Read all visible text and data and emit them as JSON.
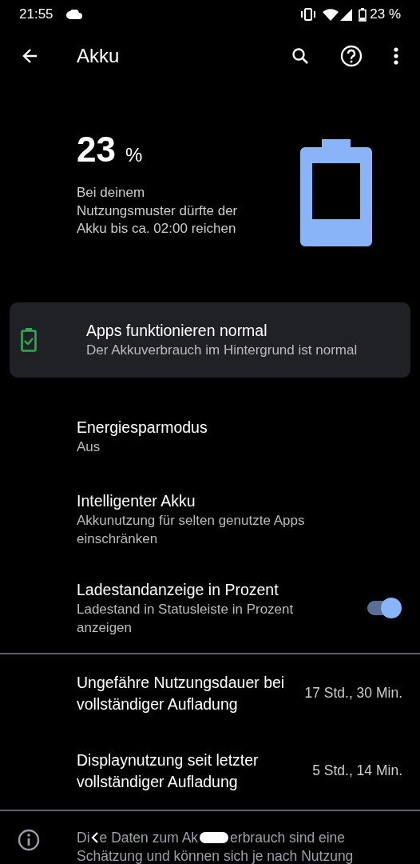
{
  "status_bar": {
    "time": "21:55",
    "battery_text": "23 %"
  },
  "toolbar": {
    "title": "Akku"
  },
  "summary": {
    "percent": "23",
    "unit": "%",
    "estimate": "Bei deinem Nutzungsmuster dürfte der Akku bis ca. 02:00 reichen"
  },
  "tip_card": {
    "title": "Apps funktionieren normal",
    "subtitle": "Der Akkuverbrauch im Hintergrund ist normal"
  },
  "settings": [
    {
      "kind": "text",
      "title": "Energiesparmodus",
      "subtitle": "Aus"
    },
    {
      "kind": "text",
      "title": "Intelligenter Akku",
      "subtitle": "Akkunutzung für selten genutzte Apps einschränken"
    },
    {
      "kind": "switch",
      "title": "Ladestandanzeige in Prozent",
      "subtitle": "Ladestand in Statusleiste in Prozent anzeigen",
      "on": true
    }
  ],
  "usage": [
    {
      "title": "Ungefähre Nutzungsdauer bei vollständiger Aufladung",
      "value": "17 Std., 30 Min."
    },
    {
      "title": "Displaynutzung seit letzter vollständiger Aufladung",
      "value": "5 Std., 14 Min."
    }
  ],
  "footer": {
    "first_line_parts": [
      "Di",
      "e Daten zum Ak",
      "erbrauch sind eine"
    ],
    "second_line": "Schätzung und können sich je nach Nutzung"
  }
}
